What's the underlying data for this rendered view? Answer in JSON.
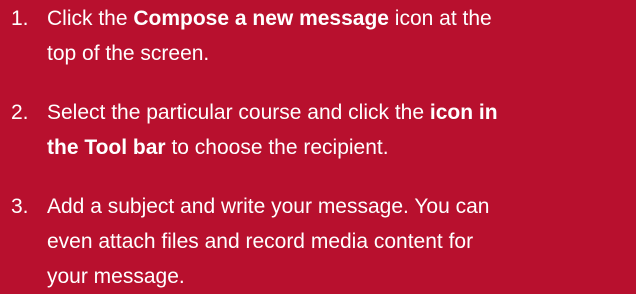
{
  "instructions": {
    "steps": [
      {
        "number": "1.",
        "lines": [
          [
            {
              "text": "Click the ",
              "bold": false
            },
            {
              "text": "Compose a new message",
              "bold": true
            },
            {
              "text": " icon at the",
              "bold": false
            }
          ],
          [
            {
              "text": "top of the screen.",
              "bold": false
            }
          ]
        ]
      },
      {
        "number": "2.",
        "lines": [
          [
            {
              "text": "Select the particular course and click the ",
              "bold": false
            },
            {
              "text": "icon in",
              "bold": true
            }
          ],
          [
            {
              "text": "the Tool bar",
              "bold": true
            },
            {
              "text": " to choose the recipient.",
              "bold": false
            }
          ]
        ]
      },
      {
        "number": "3.",
        "lines": [
          [
            {
              "text": "Add a subject and write your message. You can",
              "bold": false
            }
          ],
          [
            {
              "text": "even attach files and record media content for",
              "bold": false
            }
          ],
          [
            {
              "text": "your message.",
              "bold": false
            }
          ]
        ]
      }
    ]
  }
}
